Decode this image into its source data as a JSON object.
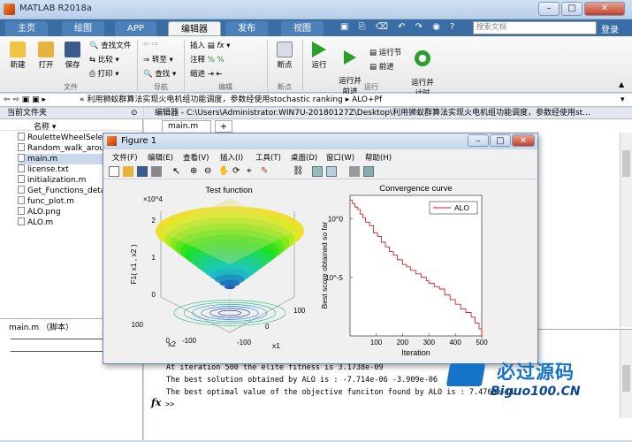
{
  "app": {
    "title": "MATLAB R2018a",
    "min": "–",
    "max": "□",
    "close": "✕"
  },
  "tabs": [
    "主页",
    "绘图",
    "APP",
    "编辑器",
    "发布",
    "视图"
  ],
  "search": {
    "placeholder": "搜索文档"
  },
  "login": "登录",
  "ribbon": {
    "new": "新建",
    "open": "打开",
    "save": "保存",
    "find_files": "查找文件",
    "compare": "比较",
    "print": "打印",
    "goto": "转至",
    "find": "查找",
    "insert": "插入",
    "comment": "注释",
    "indent": "缩进",
    "breakpoint": "断点",
    "run": "运行",
    "run_advance": "运行并\n前进",
    "run_section": "运行节",
    "advance": "前进",
    "run_time": "运行并\n计时",
    "groups": {
      "file": "文件",
      "nav": "导航",
      "edit": "编辑",
      "breakpoints": "断点",
      "run": "运行"
    }
  },
  "address": {
    "path": "« 利用狮蚁群算法实现火电机组功能调度，参数经使用stochastic ranking ▸ ALO+Pf"
  },
  "left": {
    "header": "当前文件夹",
    "col": "名称 ▾",
    "files": [
      {
        "name": "RouletteWheelSelection.m",
        "sel": false
      },
      {
        "name": "Random_walk_around.m",
        "sel": false
      },
      {
        "name": "main.m",
        "sel": true
      },
      {
        "name": "license.txt",
        "sel": false
      },
      {
        "name": "initialization.m",
        "sel": false
      },
      {
        "name": "Get_Functions_details.m",
        "sel": false
      },
      {
        "name": "func_plot.m",
        "sel": false
      },
      {
        "name": "ALO.png",
        "sel": false
      },
      {
        "name": "ALO.m",
        "sel": false
      }
    ],
    "detail": "main.m （脚本）"
  },
  "editor": {
    "header": "编辑器 - C:\\Users\\Administrator.WIN7U-20180127Z\\Desktop\\利用狮蚁群算法实现火电机组功能调度，参数经使用st...",
    "tab": "main.m",
    "plus": "+"
  },
  "cmd": {
    "lines": [
      "At iteration 500 the elite fitness is 3.1738e-09",
      "The best solution obtained by ALO is : -7.714e-06  -3.909e-06",
      "The best optimal value of the objective funciton found by ALO is : 7.4769e-11"
    ],
    "prompt": ">>",
    "fx": "fx"
  },
  "figure": {
    "title": "Figure 1",
    "menu": [
      "文件(F)",
      "编辑(E)",
      "查看(V)",
      "插入(I)",
      "工具(T)",
      "桌面(D)",
      "窗口(W)",
      "帮助(H)"
    ]
  },
  "chart_data": [
    {
      "type": "surface",
      "title": "Test function",
      "zlabel": "F1( x1 , x2 )",
      "xlabel": "x1",
      "ylabel": "x2",
      "zscale": "×10^4",
      "zticks": [
        "0",
        "1",
        "2"
      ],
      "xticks": [
        "-100",
        "0",
        "100"
      ],
      "yticks": [
        "-100",
        "0",
        "100"
      ]
    },
    {
      "type": "line",
      "title": "Convergence curve",
      "xlabel": "Iteration",
      "ylabel": "Best score obtained so far",
      "xlim": [
        1,
        500
      ],
      "yscale": "log",
      "ylim_exp": [
        -10,
        2
      ],
      "xticks": [
        100,
        200,
        300,
        400,
        500
      ],
      "yticks": [
        "10^0",
        "10^-5"
      ],
      "legend": "ALO",
      "series": [
        {
          "name": "ALO",
          "color": "#e0201c",
          "x": [
            1,
            10,
            20,
            30,
            40,
            50,
            60,
            75,
            90,
            105,
            120,
            135,
            150,
            165,
            180,
            200,
            215,
            230,
            250,
            270,
            290,
            300,
            320,
            340,
            360,
            380,
            400,
            420,
            440,
            460,
            475,
            490,
            500
          ],
          "y_exp": [
            1.6,
            1.3,
            1.0,
            0.8,
            0.4,
            0.1,
            -0.3,
            -0.6,
            -1.2,
            -1.5,
            -2.0,
            -2.4,
            -2.8,
            -3.1,
            -3.5,
            -3.9,
            -4.1,
            -4.4,
            -4.7,
            -5.0,
            -5.3,
            -5.5,
            -5.8,
            -6.0,
            -6.5,
            -6.9,
            -7.3,
            -7.7,
            -8.0,
            -8.4,
            -8.9,
            -9.4,
            -10.2
          ]
        }
      ]
    }
  ],
  "watermark": {
    "main": "必过源码",
    "sub": "Biguo100.CN"
  }
}
